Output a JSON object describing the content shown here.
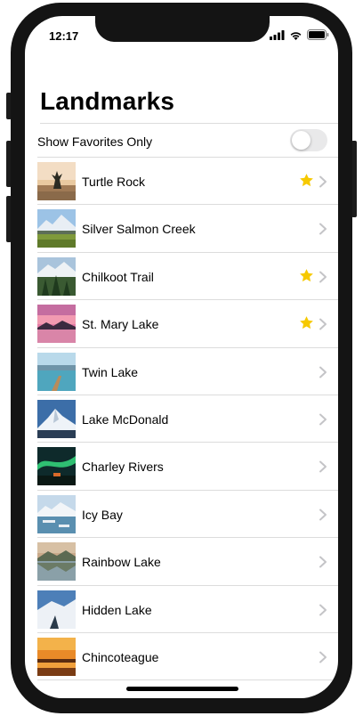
{
  "status_bar": {
    "time": "12:17",
    "icons": [
      "signal-icon",
      "wifi-icon",
      "battery-icon"
    ]
  },
  "nav": {
    "title": "Landmarks"
  },
  "favorites_toggle": {
    "label": "Show Favorites Only",
    "on": false
  },
  "landmarks": [
    {
      "name": "Turtle Rock",
      "favorite": true,
      "thumb": "desert-rock"
    },
    {
      "name": "Silver Salmon Creek",
      "favorite": false,
      "thumb": "mountain-meadow"
    },
    {
      "name": "Chilkoot Trail",
      "favorite": true,
      "thumb": "snowy-forest"
    },
    {
      "name": "St. Mary Lake",
      "favorite": true,
      "thumb": "pink-sunset-lake"
    },
    {
      "name": "Twin Lake",
      "favorite": false,
      "thumb": "lake-dock"
    },
    {
      "name": "Lake McDonald",
      "favorite": false,
      "thumb": "snow-peak"
    },
    {
      "name": "Charley Rivers",
      "favorite": false,
      "thumb": "aurora-night"
    },
    {
      "name": "Icy Bay",
      "favorite": false,
      "thumb": "icy-water"
    },
    {
      "name": "Rainbow Lake",
      "favorite": false,
      "thumb": "lake-reflection"
    },
    {
      "name": "Hidden Lake",
      "favorite": false,
      "thumb": "snow-slope"
    },
    {
      "name": "Chincoteague",
      "favorite": false,
      "thumb": "orange-sunset"
    }
  ],
  "colors": {
    "star": "#f6c900",
    "chevron": "#c4c4c7",
    "separator": "#dcdcdc"
  }
}
